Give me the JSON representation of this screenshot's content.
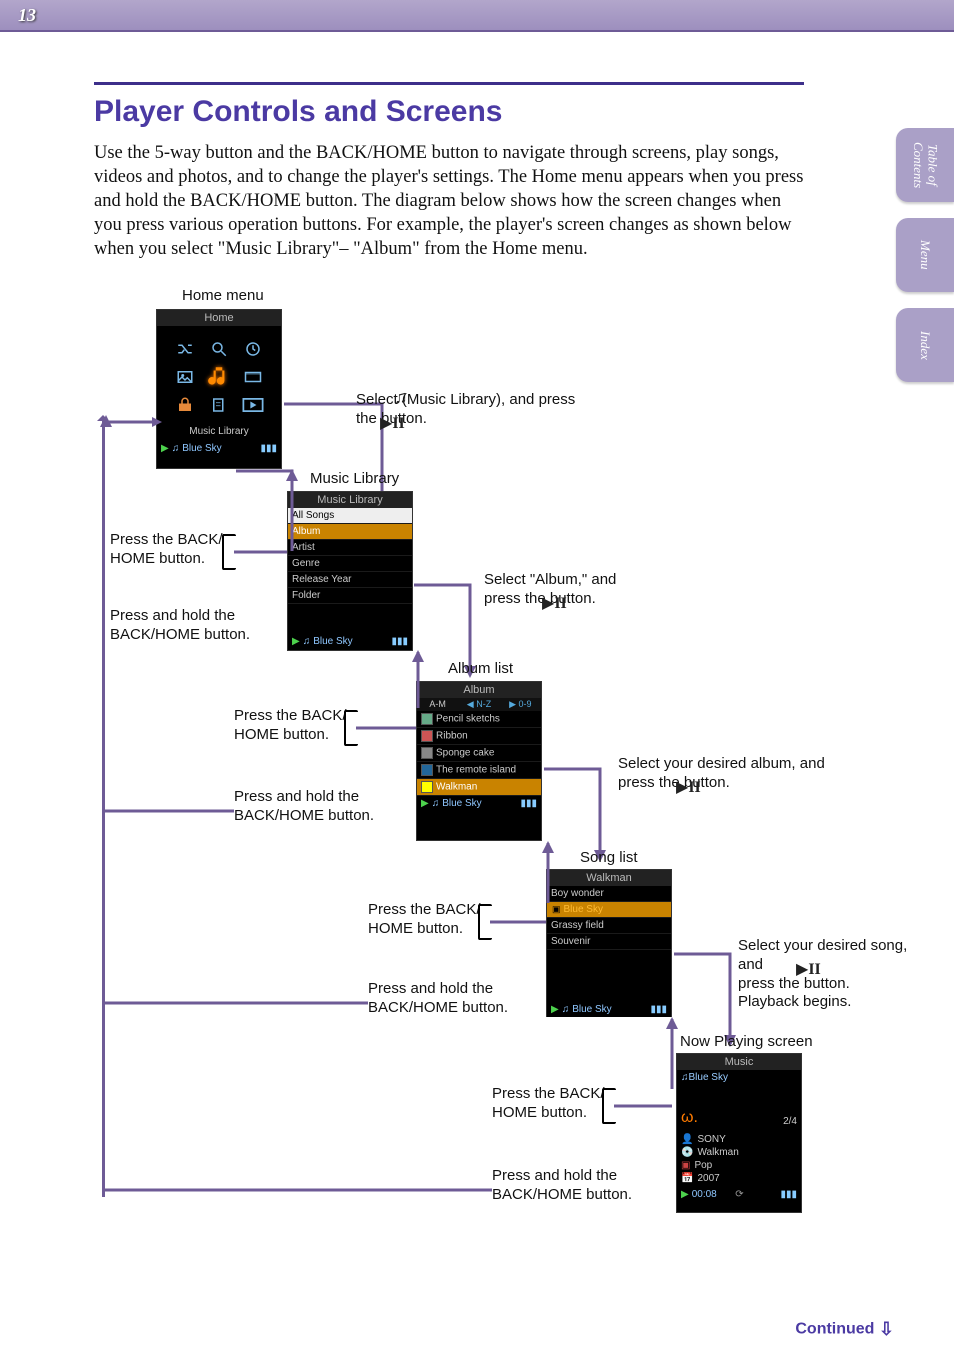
{
  "page_number": "13",
  "sidetabs": {
    "toc": "Table of\nContents",
    "menu": "Menu",
    "index": "Index"
  },
  "heading": "Player Controls and Screens",
  "intro": "Use the 5-way button and the BACK/HOME button to navigate through screens, play songs, videos and photos, and to change the player's settings. The Home menu appears when you press and hold the BACK/HOME button. The diagram below shows how the screen changes when you press various operation buttons. For example, the player's screen changes as shown below when you select \"Music Library\"– \"Album\" from the Home menu.",
  "labels": {
    "home_menu": "Home menu",
    "press_back": "Press the BACK/\nHOME button.",
    "press_hold": "Press and hold the\nBACK/HOME button.",
    "select_music_lib": "Select        (Music Library), and press\nthe         button.",
    "music_library": "Music Library",
    "select_album": "Select \"Album,\" and\npress the        button.",
    "album_list": "Album list",
    "select_desired_album": "Select your desired album, and\npress the        button.",
    "song_list": "Song list",
    "select_desired_song": "Select your desired song, and\npress the        button.\nPlayback begins.",
    "now_playing": "Now Playing screen"
  },
  "screens": {
    "home": {
      "title": "Home",
      "caption": "Music Library",
      "footer_song": "Blue Sky"
    },
    "music_library": {
      "title": "Music Library",
      "items": [
        "All Songs",
        "Album",
        "Artist",
        "Genre",
        "Release Year",
        "Folder"
      ],
      "selected_index": 1,
      "footer_song": "Blue Sky"
    },
    "album_list": {
      "title": "Album",
      "tabs": {
        "left": "A-M",
        "mid": "N-Z",
        "right": "0-9"
      },
      "items": [
        "Pencil sketchs",
        "Ribbon",
        "Sponge cake",
        "The remote island",
        "Walkman"
      ],
      "selected_index": 4,
      "footer_song": "Blue Sky"
    },
    "song_list": {
      "title": "Walkman",
      "items": [
        "Boy wonder",
        "Blue Sky",
        "Grassy field",
        "Souvenir"
      ],
      "selected_index": 1,
      "footer_song": "Blue Sky"
    },
    "now_playing": {
      "title": "Music",
      "song": "Blue Sky",
      "track": "2/4",
      "artist": "SONY",
      "album": "Walkman",
      "genre": "Pop",
      "year": "2007",
      "time": "00:08"
    }
  },
  "continued": "Continued"
}
